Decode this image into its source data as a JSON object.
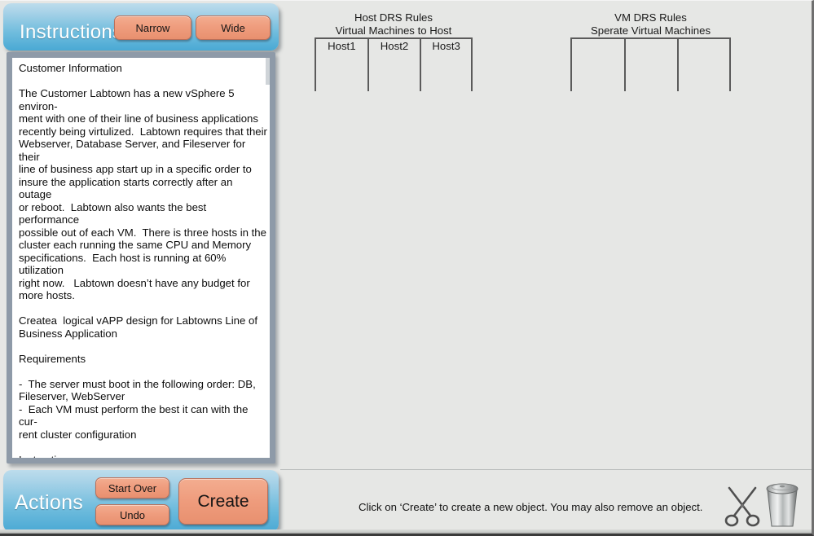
{
  "instructions_panel": {
    "title": "Instructions",
    "narrow_label": "Narrow",
    "wide_label": "Wide",
    "body": "Customer Information\n\nThe Customer Labtown has a new vSphere 5 environ-\nment with one of their line of business applications\nrecently being virtulized.  Labtown requires that their\nWebserver, Database Server, and Fileserver for their\nline of business app start up in a specific order to\ninsure the application starts correctly after an outage\nor reboot.  Labtown also wants the best performance\npossible out of each VM.  There is three hosts in the\ncluster each running the same CPU and Memory\nspecifications.  Each host is running at 60% utilization\nright now.   Labtown doesn’t have any budget for\nmore hosts.\n\nCreatea  logical vAPP design for Labtowns Line of\nBusiness Application\n\nRequirements\n\n-  The server must boot in the following order: DB,\nFileserver, WebServer\n-  Each VM must perform the best it can with the cur-\nrent cluster configuration\n\nInstructions\n-  Place the three VM’s on the vAPP\n-  Place the order boxes ontop of each VM to indi-\ncate it’s boot order.\n-  Place the VM stenicl for each VM in DRS rules if\nyou wish to apply DRS rules to the design"
  },
  "actions_panel": {
    "title": "Actions",
    "start_over_label": "Start Over",
    "undo_label": "Undo",
    "create_label": "Create"
  },
  "host_drs": {
    "title_line1": "Host DRS Rules",
    "title_line2": "Virtual Machines to Host",
    "columns": [
      {
        "label": "Host1"
      },
      {
        "label": "Host2"
      },
      {
        "label": "Host3"
      }
    ]
  },
  "vm_drs": {
    "title_line1": "VM DRS Rules",
    "title_line2": "Sperate Virtual Machines",
    "columns": [
      {
        "label": ""
      },
      {
        "label": ""
      },
      {
        "label": ""
      }
    ]
  },
  "status_bar": {
    "text": "Click on ‘Create’ to create a new object.  You may also remove an object.",
    "scissors_icon": "scissors-icon",
    "trash_icon": "trash-can-icon"
  },
  "colors": {
    "panel_blue_light": "#bddcec",
    "panel_blue_dark": "#4aa9d4",
    "button_salmon": "#ef9d7e",
    "button_border": "#b9705a",
    "canvas_background": "#e6e7e5",
    "table_line": "#5b5b5b",
    "text_frame_border": "#8e9aa8"
  }
}
